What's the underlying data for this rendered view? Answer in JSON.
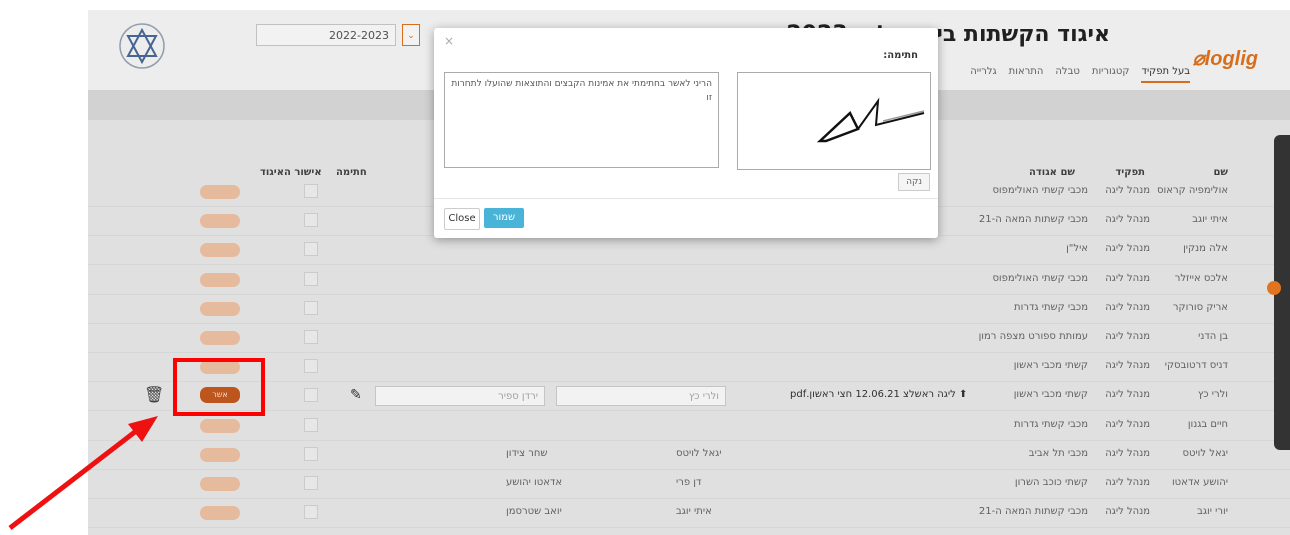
{
  "header": {
    "site_title": "איגוד הקשתות בישראל » 2023",
    "logo_text": "loglig",
    "season": "2022-2023",
    "season_button": "⌄"
  },
  "nav": {
    "tabs": [
      {
        "label": "בעל תפקיד"
      },
      {
        "label": "קטגוריות"
      },
      {
        "label": "טבלה"
      },
      {
        "label": "התראות"
      },
      {
        "label": "גלרייה"
      }
    ]
  },
  "table": {
    "headers": {
      "name": "שם",
      "role": "תפקיד",
      "club": "שם אגודה",
      "signature": "חתימה",
      "approval": "אישור האיגוד"
    },
    "rows": [
      {
        "name": "אולימפיה קראוס",
        "role": "מנהל ליגה",
        "club": "מכבי קשתי האולימפוס"
      },
      {
        "name": "איתי יוגב",
        "role": "מנהל ליגה",
        "club": "מכבי קשתות המאה ה-21"
      },
      {
        "name": "אלה מנקין",
        "role": "מנהל ליגה",
        "club": "איל\"ן"
      },
      {
        "name": "אלכס אייזלר",
        "role": "מנהל ליגה",
        "club": "מכבי קשתי האולימפוס"
      },
      {
        "name": "אריק סורוקר",
        "role": "מנהל ליגה",
        "club": "מכבי קשתי גדרות"
      },
      {
        "name": "בן הדני",
        "role": "מנהל ליגה",
        "club": "עמותת ספורט מצפה רמון"
      },
      {
        "name": "דניס דרטובסקי",
        "role": "מנהל ליגה",
        "club": "קשתי מכבי ראשון"
      },
      {
        "name": "ולרי כץ",
        "role": "מנהל ליגה",
        "club": "קשתי מכבי ראשון"
      },
      {
        "name": "חיים בגנון",
        "role": "מנהל ליגה",
        "club": "מכבי קשתי גדרות"
      },
      {
        "name": "יגאל לויטס",
        "role": "מנהל ליגה",
        "club": "מכבי תל אביב"
      },
      {
        "name": "יהושע אדאטו",
        "role": "מנהל ליגה",
        "club": "קשתי כוכב השרון"
      },
      {
        "name": "יורי יוגב",
        "role": "מנהל ליגה",
        "club": "מכבי קשתות המאה ה-21"
      }
    ],
    "selected_row": {
      "file_link": "ליגה ראשלצ 12.06.21 חצי ראשון.pdf",
      "input_referee_1": "ולרי כץ",
      "input_referee_2": "ירדן ספיר",
      "approve_button": "אשר"
    },
    "extra_rows": [
      {
        "col_a": "יגאל לויטס",
        "col_b": "שחר צידון"
      },
      {
        "col_a": "דן פרי",
        "col_b": "אדאטו יהושע"
      },
      {
        "col_a": "איתי יוגב",
        "col_b": "יואב שטרסמן"
      }
    ]
  },
  "modal": {
    "title_label": "חתימה:",
    "declaration_text": "הריני לאשר בחתימתי את אמינות הקבצים והתוצאות שהועלו לתחרות זו",
    "clear_button": "נקה",
    "close_button": "Close",
    "save_button": "שמור",
    "close_x": "×"
  }
}
